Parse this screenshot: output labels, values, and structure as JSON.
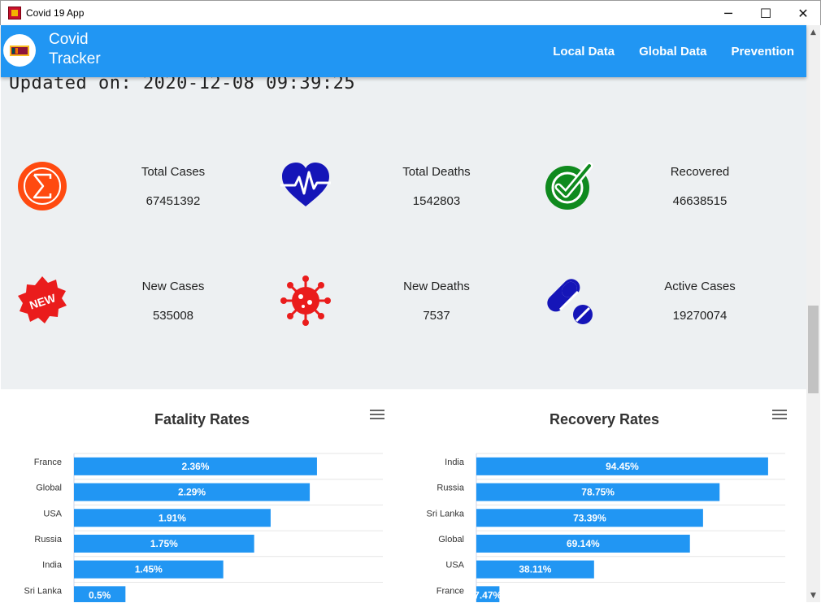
{
  "window": {
    "title": "Covid 19 App",
    "minimize_glyph": "─",
    "maximize_glyph": "☐",
    "close_glyph": "✕"
  },
  "navbar": {
    "brand_line1": "Covid",
    "brand_line2": "Tracker",
    "links": [
      "Local Data",
      "Global Data",
      "Prevention"
    ]
  },
  "updated": "Updated on: 2020-12-08 09:39:25",
  "stats": [
    {
      "label": "Total Cases",
      "value": "67451392",
      "icon": "sigma-icon",
      "color": "#ff4a10"
    },
    {
      "label": "Total Deaths",
      "value": "1542803",
      "icon": "heartbeat-icon",
      "color": "#1515b8"
    },
    {
      "label": "Recovered",
      "value": "46638515",
      "icon": "check-circle-icon",
      "color": "#0f8a1e"
    },
    {
      "label": "New Cases",
      "value": "535008",
      "icon": "new-badge-icon",
      "color": "#ea1c1c"
    },
    {
      "label": "New Deaths",
      "value": "7537",
      "icon": "virus-icon",
      "color": "#ea1c1c"
    },
    {
      "label": "Active Cases",
      "value": "19270074",
      "icon": "pills-icon",
      "color": "#1515b8"
    }
  ],
  "chart_data": [
    {
      "type": "bar",
      "orientation": "horizontal",
      "title": "Fatality Rates",
      "categories": [
        "France",
        "Global",
        "USA",
        "Russia",
        "India",
        "Sri Lanka"
      ],
      "values": [
        2.36,
        2.29,
        1.91,
        1.75,
        1.45,
        0.5
      ],
      "data_labels": [
        "2.36%",
        "2.29%",
        "1.91%",
        "1.75%",
        "1.45%",
        "0.5%"
      ],
      "xlim": [
        0,
        3
      ],
      "color": "#2196f3",
      "grid": true
    },
    {
      "type": "bar",
      "orientation": "horizontal",
      "title": "Recovery Rates",
      "categories": [
        "India",
        "Russia",
        "Sri Lanka",
        "Global",
        "USA",
        "France"
      ],
      "values": [
        94.45,
        78.75,
        73.39,
        69.14,
        38.11,
        7.47
      ],
      "data_labels": [
        "94.45%",
        "78.75%",
        "73.39%",
        "69.14%",
        "38.11%",
        "7.47%"
      ],
      "xlim": [
        0,
        100
      ],
      "color": "#2196f3",
      "grid": true
    }
  ]
}
